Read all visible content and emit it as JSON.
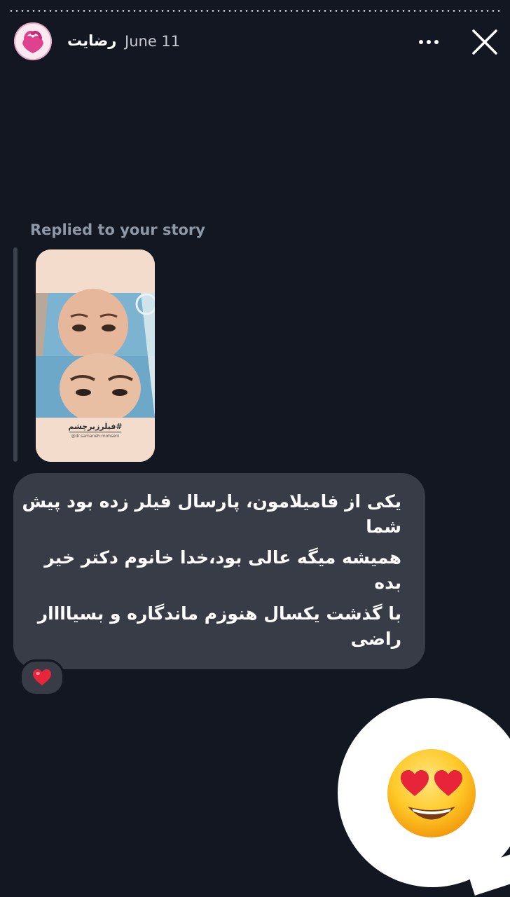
{
  "header": {
    "username": "رضایت",
    "timestamp": "June 11",
    "more_icon": "more-horizontal-icon",
    "close_icon": "close-icon"
  },
  "reply": {
    "label": "Replied to your story",
    "story": {
      "caption": "#فیلرزیرچشم",
      "handle": "@dr.samaneh.mohseni"
    }
  },
  "message": {
    "lines": [
      "یکی از فامیلامون، پارسال فیلر زده بود پیش",
      "شما",
      "همیشه میگه عالی بود،خدا خانوم دکتر خیر",
      "بده",
      "با گذشت یکسال هنوزم ماندگاره و بسیاااار",
      "راضی"
    ],
    "reaction": "heart-icon"
  },
  "sticker": "heart-eyes-emoji-icon",
  "colors": {
    "background": "#121722",
    "bubble": "#373c46",
    "muted_text": "#8f98a6"
  }
}
